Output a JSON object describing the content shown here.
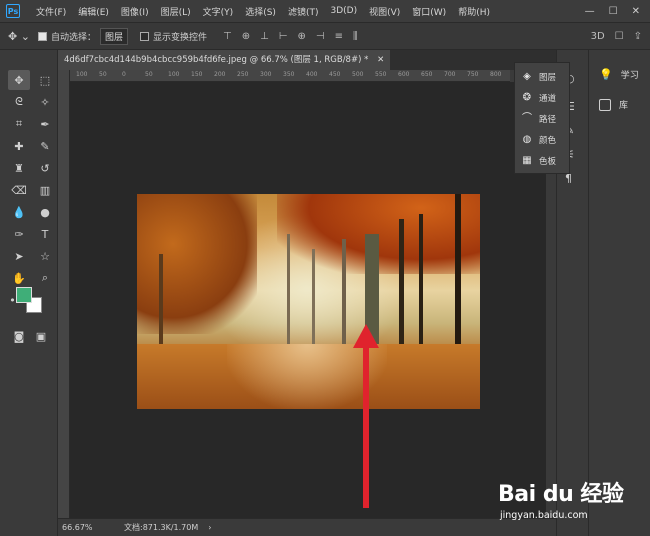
{
  "app": {
    "logo": "Ps"
  },
  "menu": [
    "文件(F)",
    "编辑(E)",
    "图像(I)",
    "图层(L)",
    "文字(Y)",
    "选择(S)",
    "滤镜(T)",
    "3D(D)",
    "视图(V)",
    "窗口(W)",
    "帮助(H)"
  ],
  "window_controls": {
    "minimize": "—",
    "restore": "☐",
    "close": "✕"
  },
  "options": {
    "auto_select_label": "自动选择：",
    "auto_select_checked": true,
    "auto_select_value": "图层",
    "show_transform_label": "显示变换控件",
    "show_transform_checked": false
  },
  "document_tab": {
    "title": "4d6df7cbc4d144b9b4cbcc959b4fd6fe.jpeg @ 66.7% (图层 1, RGB/8#) *",
    "close": "✕"
  },
  "ruler": {
    "ticks": [
      "100",
      "50",
      "0",
      "50",
      "100",
      "150",
      "200",
      "250",
      "300",
      "350",
      "400",
      "450",
      "500",
      "550",
      "600",
      "650",
      "700",
      "750",
      "800"
    ]
  },
  "status": {
    "zoom": "66.67%",
    "doc": "文档:871.3K/1.70M",
    "caret": "›"
  },
  "layers_flyout": {
    "items": [
      {
        "label": "图层",
        "icon": "layers-icon"
      },
      {
        "label": "通道",
        "icon": "channels-icon"
      },
      {
        "label": "路径",
        "icon": "paths-icon"
      },
      {
        "label": "颜色",
        "icon": "color-icon"
      },
      {
        "label": "色板",
        "icon": "swatches-icon"
      }
    ]
  },
  "right_panel": {
    "items": [
      {
        "label": "学习",
        "icon": "lightbulb-icon"
      },
      {
        "label": "库",
        "icon": "library-icon"
      }
    ]
  },
  "colors": {
    "foreground": "#3fae78",
    "background": "#ffffff",
    "arrow": "#e0232d"
  },
  "watermark": {
    "logo": "Bai du 经验",
    "url": "jingyan.baidu.com"
  }
}
